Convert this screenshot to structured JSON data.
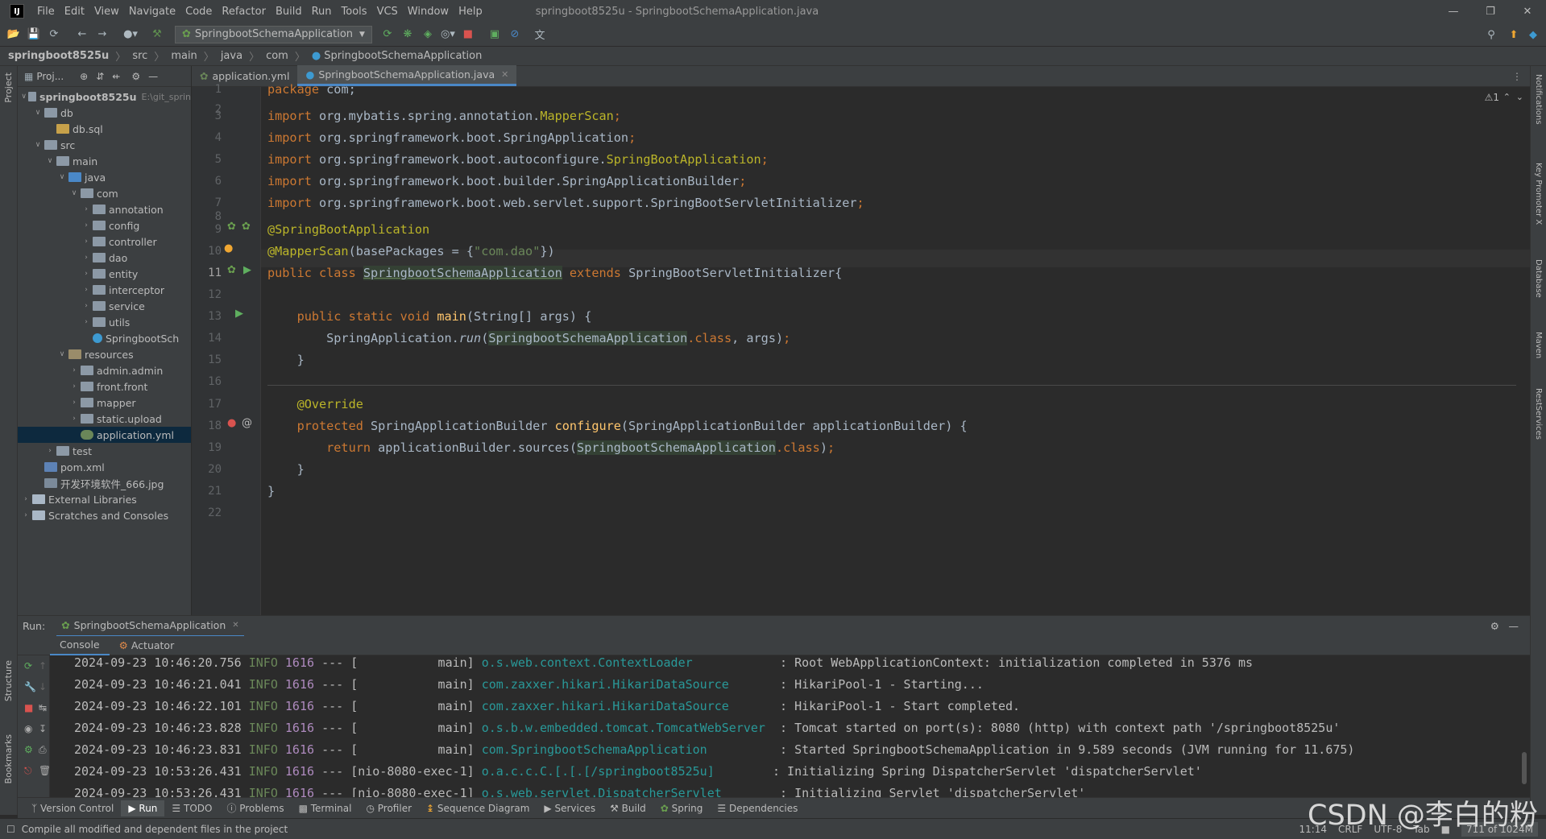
{
  "menubar": {
    "items": [
      "File",
      "Edit",
      "View",
      "Navigate",
      "Code",
      "Refactor",
      "Build",
      "Run",
      "Tools",
      "VCS",
      "Window",
      "Help"
    ],
    "window_title": "springboot8525u - SpringbootSchemaApplication.java"
  },
  "toolbar": {
    "run_config": "SpringbootSchemaApplication"
  },
  "breadcrumb": [
    "springboot8525u",
    "src",
    "main",
    "java",
    "com",
    "SpringbootSchemaApplication"
  ],
  "left_stripe": {
    "project": "Project",
    "structure": "Structure",
    "bookmarks": "Bookmarks"
  },
  "right_stripe": [
    "Notifications",
    "Key Promoter X",
    "Database",
    "Maven",
    "RestServices"
  ],
  "project_panel": {
    "header": "Proj...",
    "tree": [
      {
        "label": "springboot8525u",
        "extra": "E:\\git_sprin",
        "level": 0,
        "icon": "module"
      },
      {
        "label": "db",
        "level": 1,
        "icon": "folder"
      },
      {
        "label": "db.sql",
        "level": 2,
        "icon": "sql"
      },
      {
        "label": "src",
        "level": 1,
        "icon": "folder"
      },
      {
        "label": "main",
        "level": 2,
        "icon": "folder"
      },
      {
        "label": "java",
        "level": 3,
        "icon": "src"
      },
      {
        "label": "com",
        "level": 4,
        "icon": "folder"
      },
      {
        "label": "annotation",
        "level": 5,
        "icon": "folder"
      },
      {
        "label": "config",
        "level": 5,
        "icon": "folder"
      },
      {
        "label": "controller",
        "level": 5,
        "icon": "folder"
      },
      {
        "label": "dao",
        "level": 5,
        "icon": "folder"
      },
      {
        "label": "entity",
        "level": 5,
        "icon": "folder"
      },
      {
        "label": "interceptor",
        "level": 5,
        "icon": "folder"
      },
      {
        "label": "service",
        "level": 5,
        "icon": "folder"
      },
      {
        "label": "utils",
        "level": 5,
        "icon": "folder"
      },
      {
        "label": "SpringbootSch",
        "level": 5,
        "icon": "java"
      },
      {
        "label": "resources",
        "level": 3,
        "icon": "res"
      },
      {
        "label": "admin.admin",
        "level": 4,
        "icon": "folder"
      },
      {
        "label": "front.front",
        "level": 4,
        "icon": "folder"
      },
      {
        "label": "mapper",
        "level": 4,
        "icon": "folder"
      },
      {
        "label": "static.upload",
        "level": 4,
        "icon": "folder"
      },
      {
        "label": "application.yml",
        "level": 4,
        "icon": "yml",
        "selected": true
      },
      {
        "label": "test",
        "level": 2,
        "icon": "folder"
      },
      {
        "label": "pom.xml",
        "level": 1,
        "icon": "xml"
      },
      {
        "label": "开发环境软件_666.jpg",
        "level": 1,
        "icon": "img"
      },
      {
        "label": "External Libraries",
        "level": 0,
        "icon": "lib"
      },
      {
        "label": "Scratches and Consoles",
        "level": 0,
        "icon": "lib"
      }
    ]
  },
  "editor": {
    "tabs": [
      {
        "label": "application.yml",
        "active": false
      },
      {
        "label": "SpringbootSchemaApplication.java",
        "active": true
      }
    ],
    "warning_badge": "⚠1",
    "line_numbers": [
      "1",
      "2",
      "3",
      "4",
      "5",
      "6",
      "7",
      "8",
      "9",
      "10",
      "11",
      "12",
      "13",
      "14",
      "15",
      "16",
      "17",
      "18",
      "19",
      "20",
      "21",
      "22"
    ],
    "code": {
      "l1_kw": "package",
      "l1_rest": " com;",
      "l3_kw": "import",
      "l3_rest": " org.mybatis.spring.annotation.",
      "l3_ann": "MapperScan",
      "l3_end": ";",
      "l4_kw": "import",
      "l4_rest": " org.springframework.boot.SpringApplication",
      "l4_end": ";",
      "l5_kw": "import",
      "l5_rest": " org.springframework.boot.autoconfigure.",
      "l5_ann": "SpringBootApplication",
      "l5_end": ";",
      "l6_kw": "import",
      "l6_rest": " org.springframework.boot.builder.SpringApplicationBuilder",
      "l6_end": ";",
      "l7_kw": "import",
      "l7_rest": " org.springframework.boot.web.servlet.support.SpringBootServletInitializer",
      "l7_end": ";",
      "l9_ann": "@SpringBootApplication",
      "l10_ann": "@MapperScan",
      "l10_rest": "(basePackages = {",
      "l10_str": "\"com.dao\"",
      "l10_end": "})",
      "l11_kw1": "public class ",
      "l11_cls": "SpringbootSchemaApplication",
      "l11_kw2": " extends ",
      "l11_rest": "SpringBootServletInitializer{",
      "l13_kw": "    public static void ",
      "l13_fn": "main",
      "l13_rest": "(String[] args) {",
      "l14_a": "        SpringApplication.",
      "l14_fn": "run",
      "l14_b": "(",
      "l14_cls": "SpringbootSchemaApplication",
      "l14_kw": ".class",
      "l14_c": ", args)",
      "l14_end": ";",
      "l15": "    }",
      "l17_ann": "    @Override",
      "l18_kw": "    protected ",
      "l18_a": "SpringApplicationBuilder ",
      "l18_fn": "configure",
      "l18_b": "(SpringApplicationBuilder applicationBuilder) {",
      "l19_kw": "        return ",
      "l19_a": "applicationBuilder.sources(",
      "l19_cls": "SpringbootSchemaApplication",
      "l19_kw2": ".class",
      "l19_b": ")",
      "l19_end": ";",
      "l20": "    }",
      "l21": "}"
    }
  },
  "run_panel": {
    "label": "Run:",
    "config_tab": "SpringbootSchemaApplication",
    "subtabs": [
      "Console",
      "Actuator"
    ],
    "log": [
      {
        "ts": "2024-09-23 10:46:20.756",
        "level": "INFO",
        "pid": "1616",
        "sep": "---",
        "thread": "[           main]",
        "logger": "o.s.web.context.ContextLoader           ",
        "msg": ": Root WebApplicationContext: initialization completed in 5376 ms"
      },
      {
        "ts": "2024-09-23 10:46:21.041",
        "level": "INFO",
        "pid": "1616",
        "sep": "---",
        "thread": "[           main]",
        "logger": "com.zaxxer.hikari.HikariDataSource      ",
        "msg": ": HikariPool-1 - Starting..."
      },
      {
        "ts": "2024-09-23 10:46:22.101",
        "level": "INFO",
        "pid": "1616",
        "sep": "---",
        "thread": "[           main]",
        "logger": "com.zaxxer.hikari.HikariDataSource      ",
        "msg": ": HikariPool-1 - Start completed."
      },
      {
        "ts": "2024-09-23 10:46:23.828",
        "level": "INFO",
        "pid": "1616",
        "sep": "---",
        "thread": "[           main]",
        "logger": "o.s.b.w.embedded.tomcat.TomcatWebServer ",
        "msg": ": Tomcat started on port(s): 8080 (http) with context path '/springboot8525u'"
      },
      {
        "ts": "2024-09-23 10:46:23.831",
        "level": "INFO",
        "pid": "1616",
        "sep": "---",
        "thread": "[           main]",
        "logger": "com.SpringbootSchemaApplication         ",
        "msg": ": Started SpringbootSchemaApplication in 9.589 seconds (JVM running for 11.675)"
      },
      {
        "ts": "2024-09-23 10:53:26.431",
        "level": "INFO",
        "pid": "1616",
        "sep": "---",
        "thread": "[nio-8080-exec-1]",
        "logger": "o.a.c.c.C.[.[.[/springboot8525u]       ",
        "msg": ": Initializing Spring DispatcherServlet 'dispatcherServlet'"
      },
      {
        "ts": "2024-09-23 10:53:26.431",
        "level": "INFO",
        "pid": "1616",
        "sep": "---",
        "thread": "[nio-8080-exec-1]",
        "logger": "o.s.web.servlet.DispatcherServlet       ",
        "msg": ": Initializing Servlet 'dispatcherServlet'"
      }
    ]
  },
  "tool_windows": [
    "Version Control",
    "Run",
    "TODO",
    "Problems",
    "Terminal",
    "Profiler",
    "Sequence Diagram",
    "Services",
    "Build",
    "Spring",
    "Dependencies"
  ],
  "status": {
    "message": "Compile all modified and dependent files in the project",
    "position": "11:14",
    "line_sep": "CRLF",
    "encoding": "UTF-8",
    "indent": "Tab",
    "memory": "711 of 1024M"
  },
  "watermark": "CSDN @李白的粉"
}
